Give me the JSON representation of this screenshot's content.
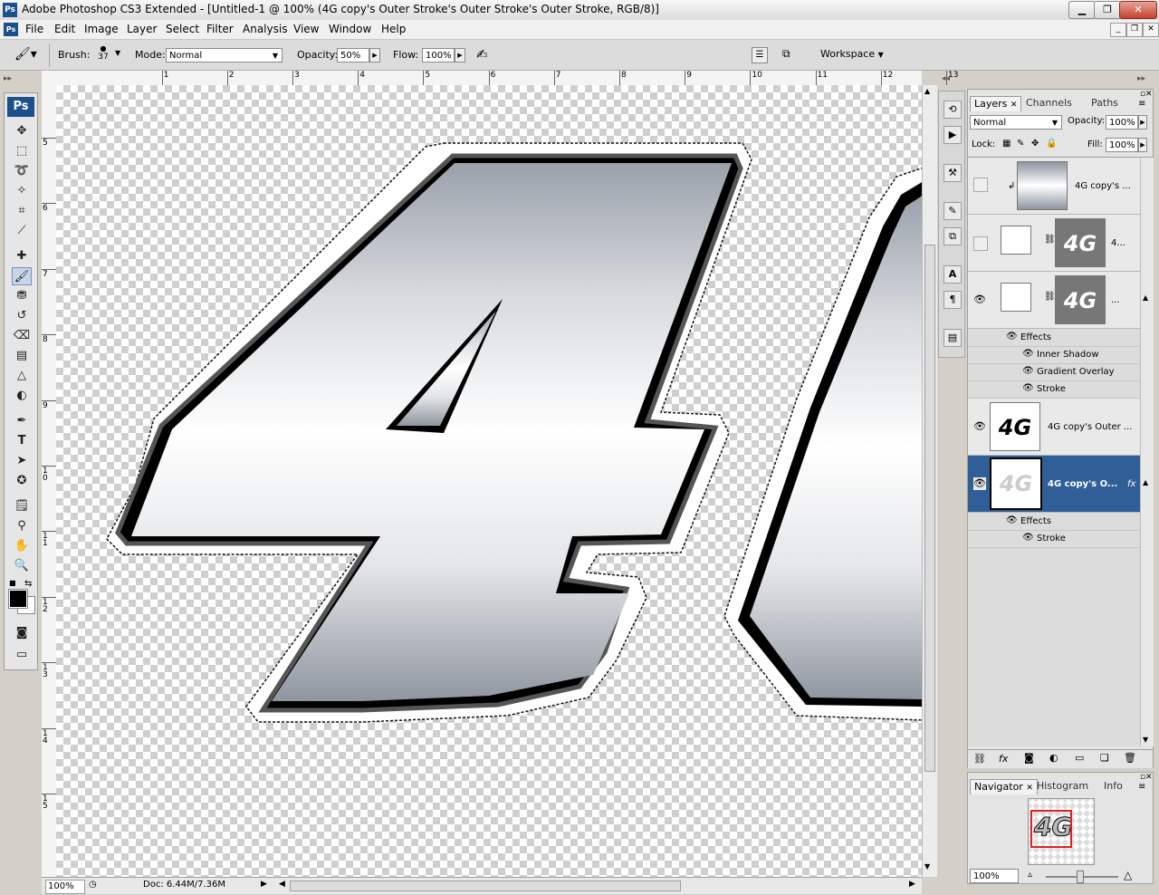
{
  "title": "Adobe Photoshop CS3 Extended - [Untitled-1 @ 100% (4G copy's Outer Stroke's Outer Stroke's Outer Stroke, RGB/8)]",
  "menu": [
    "File",
    "Edit",
    "Image",
    "Layer",
    "Select",
    "Filter",
    "Analysis",
    "View",
    "Window",
    "Help"
  ],
  "options": {
    "brush_label": "Brush:",
    "brush_size": "37",
    "mode_label": "Mode:",
    "mode_value": "Normal",
    "opacity_label": "Opacity:",
    "opacity_value": "50%",
    "flow_label": "Flow:",
    "flow_value": "100%",
    "workspace": "Workspace"
  },
  "ruler_top": [
    "1",
    "2",
    "3",
    "4",
    "5",
    "6",
    "7",
    "8",
    "9",
    "10",
    "11",
    "12",
    "13"
  ],
  "ruler_left": [
    "5",
    "6",
    "7",
    "8",
    "9",
    "1 0",
    "1 1",
    "1 2",
    "1 3",
    "1 4",
    "1 5"
  ],
  "status": {
    "zoom": "100%",
    "doc": "Doc: 6.44M/7.36M"
  },
  "layers_panel": {
    "tabs": [
      "Layers",
      "Channels",
      "Paths"
    ],
    "blend_mode": "Normal",
    "opacity_label": "Opacity:",
    "opacity_value": "100%",
    "lock_label": "Lock:",
    "fill_label": "Fill:",
    "fill_value": "100%",
    "layers": [
      {
        "name": "4G copy's ...",
        "visible": false
      },
      {
        "name": "4...",
        "visible": false
      },
      {
        "name": "...",
        "visible": true
      },
      {
        "name": "4G copy's Outer ...",
        "visible": true
      },
      {
        "name": "4G copy's O...",
        "visible": true,
        "selected": true
      }
    ],
    "effects_label": "Effects",
    "effects_group1": [
      "Inner Shadow",
      "Gradient Overlay",
      "Stroke"
    ],
    "effects_group2": [
      "Stroke"
    ],
    "thumb_text": "4G"
  },
  "navigator_panel": {
    "tabs": [
      "Navigator",
      "Histogram",
      "Info"
    ],
    "zoom": "100%"
  },
  "colors": {
    "selection": "#2f5f96",
    "ps_blue": "#1c4f8c"
  }
}
